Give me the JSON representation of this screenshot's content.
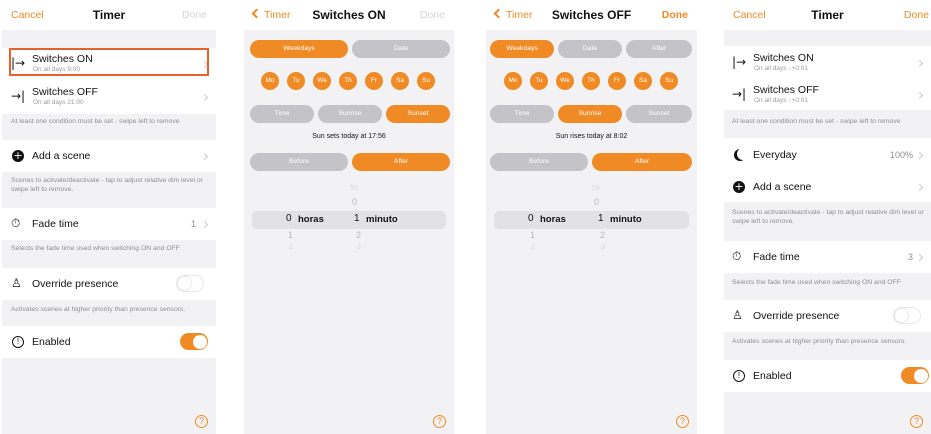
{
  "colors": {
    "accent": "#f08a24",
    "highlight": "#e8612a",
    "muted_pill": "#c4c4c8"
  },
  "icons": [
    "switch-on-icon",
    "switch-off-icon",
    "plus-circle-icon",
    "timer-icon",
    "presence-icon",
    "info-icon",
    "chevron-left-icon",
    "chevron-right-icon",
    "help-icon",
    "moon-icon"
  ],
  "screen1": {
    "cancel": "Cancel",
    "title": "Timer",
    "done": "Done",
    "switches_on": {
      "title": "Switches ON",
      "sub": "On all days  9:00"
    },
    "switches_off": {
      "title": "Switches OFF",
      "sub": "On all days  21:00"
    },
    "condition_hint": "At least one condition must be set - swipe left to remove",
    "add_scene": "Add a scene",
    "scenes_hint": "Scenes to activate/deactivate - tap to adjust relative dim level or swipe left to remove.",
    "fade_time": "Fade time",
    "fade_value": "1",
    "fade_hint": "Selects the fade time used when switching ON and OFF",
    "override": "Override presence",
    "override_hint": "Activates scenes at higher priority than presence sensors.",
    "enabled": "Enabled",
    "help": "?"
  },
  "screen2": {
    "back": "Timer",
    "title": "Switches ON",
    "done": "Done",
    "mode_weekdays": "Weekdays",
    "mode_date": "Date",
    "days": [
      "Mo",
      "Tu",
      "We",
      "Th",
      "Fr",
      "Sa",
      "Su"
    ],
    "time_tab": "Time",
    "sunrise_tab": "Sunrise",
    "sunset_tab": "Sunset",
    "info": "Sun sets today at 17:56",
    "before": "Before",
    "after": "After",
    "picker": {
      "top2": "59",
      "top1": "0",
      "hours_value": "0",
      "hours_label": "horas",
      "minutes_value": "1",
      "minutes_label": "minuto",
      "hours_next": "1",
      "hours_next2": "2",
      "minutes_next": "2",
      "minutes_next2": "3"
    },
    "help": "?"
  },
  "screen3": {
    "back": "Timer",
    "title": "Switches OFF",
    "done": "Done",
    "mode_weekdays": "Weekdays",
    "mode_date": "Date",
    "mode_after": "After",
    "days": [
      "Mo",
      "Tu",
      "We",
      "Th",
      "Fr",
      "Sa",
      "Su"
    ],
    "time_tab": "Time",
    "sunrise_tab": "Sunrise",
    "sunset_tab": "Sunset",
    "info": "Sun rises today at 8:02",
    "before": "Before",
    "after": "After",
    "picker": {
      "top2": "59",
      "top1": "0",
      "hours_value": "0",
      "hours_label": "horas",
      "minutes_value": "1",
      "minutes_label": "minuto",
      "hours_next": "1",
      "hours_next2": "2",
      "minutes_next": "2",
      "minutes_next2": "3"
    },
    "help": "?"
  },
  "screen4": {
    "cancel": "Cancel",
    "title": "Timer",
    "done": "Done",
    "switches_on": {
      "title": "Switches ON",
      "sub": "On all days  ↓+0:01"
    },
    "switches_off": {
      "title": "Switches OFF",
      "sub": "On all days  ↑+0:01"
    },
    "condition_hint": "At least one condition must be set - swipe left to remove",
    "everyday": "Everyday",
    "everyday_value": "100%",
    "add_scene": "Add a scene",
    "scenes_hint": "Scenes to activate/deactivate - tap to adjust relative dim level or swipe left to remove.",
    "fade_time": "Fade time",
    "fade_value": "3",
    "fade_hint": "Selects the fade time used when switching ON and OFF",
    "override": "Override presence",
    "override_hint": "Activates scenes at higher priority than presence sensors.",
    "enabled": "Enabled",
    "help": "?"
  }
}
